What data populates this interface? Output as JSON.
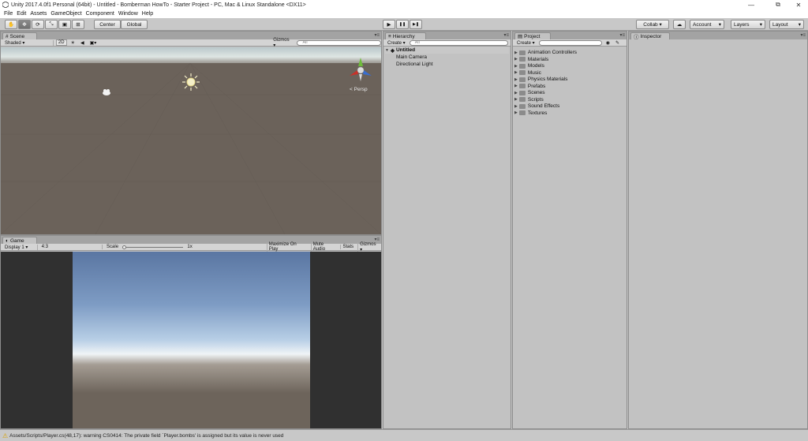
{
  "window": {
    "title": "Unity 2017.4.0f1 Personal (64bit) - Untitled - Bomberman HowTo - Starter Project - PC, Mac & Linux Standalone <DX11>",
    "minimize": "—",
    "restore": "⧉",
    "close": "✕"
  },
  "menu": [
    "File",
    "Edit",
    "Assets",
    "GameObject",
    "Component",
    "Window",
    "Help"
  ],
  "toolbar": {
    "pivot": "Center",
    "space": "Global",
    "play": "▶",
    "pause": "❚❚",
    "step": "▶❚",
    "collab": "Collab ▾",
    "account": "Account",
    "layers": "Layers",
    "layout": "Layout"
  },
  "scene": {
    "tab": "Scene",
    "shading": "Shaded",
    "mode2d": "2D",
    "gizmos": "Gizmos",
    "search_placeholder": "All",
    "persp": "Persp"
  },
  "game": {
    "tab": "Game",
    "display": "Display 1",
    "aspect": "4:3",
    "scale_label": "Scale",
    "scale_value": "1x",
    "maximize": "Maximize On Play",
    "mute": "Mute Audio",
    "stats": "Stats",
    "gizmos": "Gizmos"
  },
  "hierarchy": {
    "tab": "Hierarchy",
    "create": "Create",
    "search_placeholder": "All",
    "scene": "Untitled",
    "items": [
      "Main Camera",
      "Directional Light"
    ]
  },
  "project": {
    "tab": "Project",
    "create": "Create",
    "folders": [
      "Animation Controllers",
      "Materials",
      "Models",
      "Music",
      "Physics Materials",
      "Prefabs",
      "Scenes",
      "Scripts",
      "Sound Effects",
      "Textures"
    ]
  },
  "inspector": {
    "tab": "Inspector"
  },
  "status": {
    "message": "Assets/Scripts/Player.cs(48,17): warning CS0414: The private field `Player.bombs' is assigned but its value is never used"
  }
}
